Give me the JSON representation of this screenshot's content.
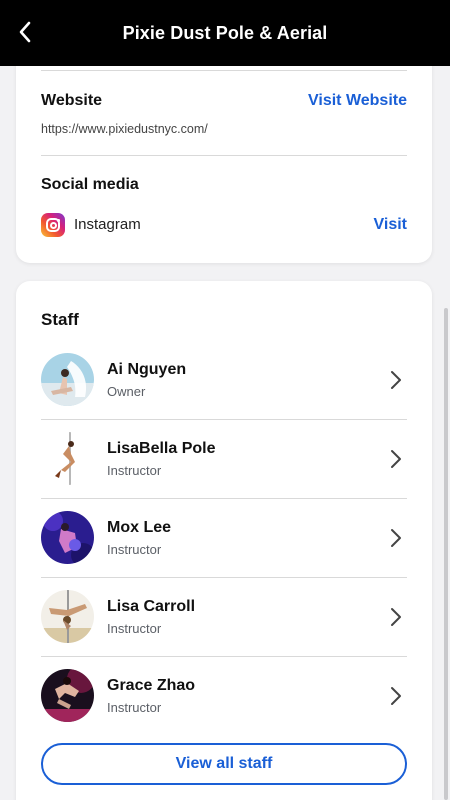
{
  "header": {
    "title": "Pixie Dust Pole & Aerial",
    "back_icon": "chevron-left-icon"
  },
  "website": {
    "label": "Website",
    "link_label": "Visit Website",
    "url": "https://www.pixiedustnyc.com/"
  },
  "social": {
    "label": "Social media",
    "items": [
      {
        "icon": "instagram-icon",
        "name": "Instagram",
        "link_label": "Visit"
      }
    ]
  },
  "staff": {
    "title": "Staff",
    "members": [
      {
        "name": "Ai Nguyen",
        "role": "Owner"
      },
      {
        "name": "LisaBella Pole",
        "role": "Instructor"
      },
      {
        "name": "Mox Lee",
        "role": "Instructor"
      },
      {
        "name": "Lisa Carroll",
        "role": "Instructor"
      },
      {
        "name": "Grace Zhao",
        "role": "Instructor"
      }
    ],
    "view_all_label": "View all staff"
  },
  "colors": {
    "accent": "#1a5fd6",
    "header_bg": "#000000"
  }
}
